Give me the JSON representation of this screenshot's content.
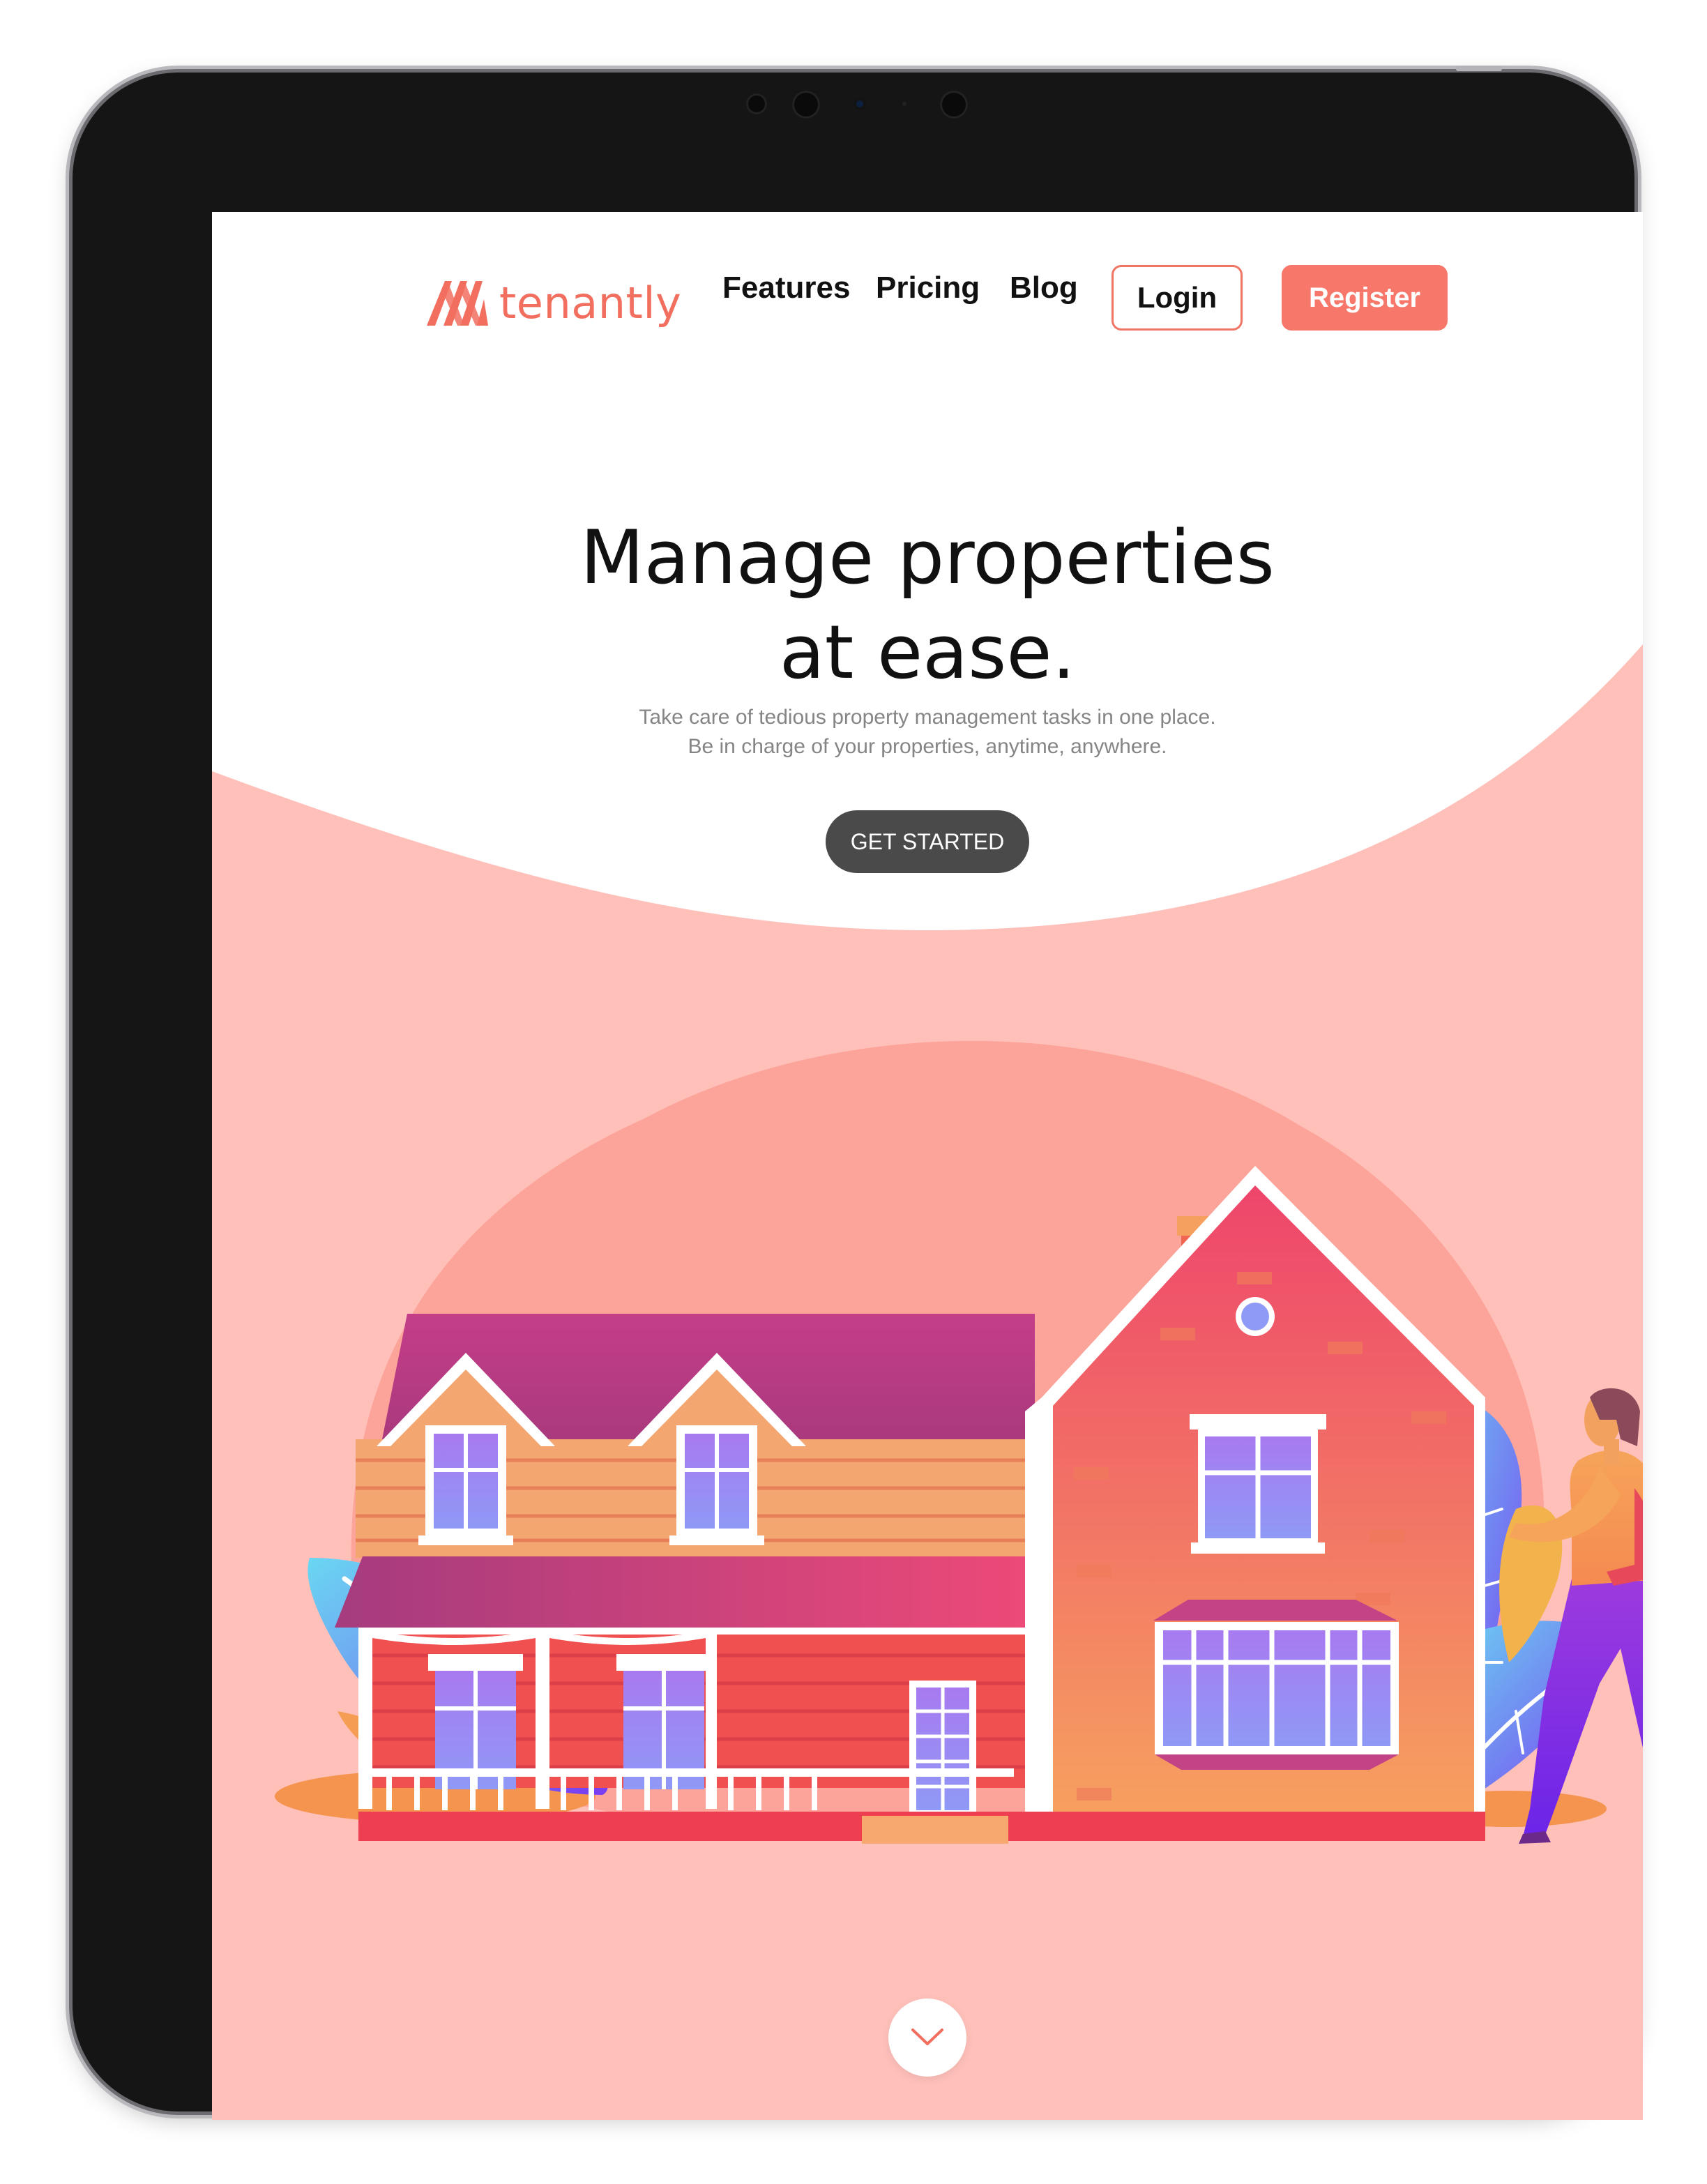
{
  "brand": {
    "name": "tenantly",
    "logo_icon": "tenantly-logo-icon",
    "color": "#f26f5f"
  },
  "nav": {
    "links": [
      {
        "label": "Features"
      },
      {
        "label": "Pricing"
      },
      {
        "label": "Blog"
      }
    ],
    "login_label": "Login",
    "register_label": "Register"
  },
  "hero": {
    "title_line1": "Manage properties",
    "title_line2": "at ease.",
    "subtitle_line1": "Take care of tedious property management tasks in one place.",
    "subtitle_line2": "Be in charge of your properties, anytime, anywhere.",
    "cta_label": "GET STARTED"
  },
  "scroll": {
    "icon": "chevron-down-icon"
  },
  "colors": {
    "accent": "#f7786a",
    "hero_wave": "#ffc0ba",
    "blob": "#fda49a",
    "cta_bg": "#4a4a4a"
  }
}
